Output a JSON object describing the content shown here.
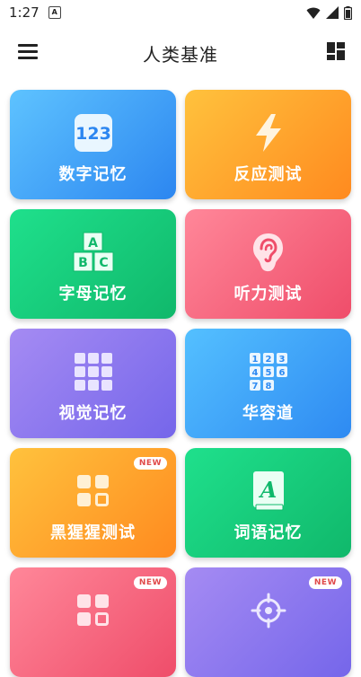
{
  "status": {
    "time": "1:27",
    "notif_icon": "a-icon"
  },
  "appbar": {
    "title": "人类基准",
    "menu_icon": "hamburger-menu-icon",
    "layout_icon": "dashboard-grid-icon"
  },
  "cards": [
    {
      "id": "number-memory",
      "label": "数字记忆",
      "icon": "number-123-icon",
      "badge": ""
    },
    {
      "id": "reaction-test",
      "label": "反应测试",
      "icon": "lightning-icon",
      "badge": ""
    },
    {
      "id": "letter-memory",
      "label": "字母记忆",
      "icon": "abc-blocks-icon",
      "badge": ""
    },
    {
      "id": "hearing-test",
      "label": "听力测试",
      "icon": "ear-icon",
      "badge": ""
    },
    {
      "id": "visual-memory",
      "label": "视觉记忆",
      "icon": "grid-squares-icon",
      "badge": ""
    },
    {
      "id": "klotski",
      "label": "华容道",
      "icon": "number-tiles-icon",
      "badge": ""
    },
    {
      "id": "chimp-test",
      "label": "黑猩猩测试",
      "icon": "four-squares-icon",
      "badge": "NEW"
    },
    {
      "id": "word-memory",
      "label": "词语记忆",
      "icon": "book-a-icon",
      "badge": ""
    },
    {
      "id": "card-9",
      "label": "",
      "icon": "four-squares-icon",
      "badge": "NEW"
    },
    {
      "id": "card-10",
      "label": "",
      "icon": "target-icon",
      "badge": "NEW"
    }
  ],
  "colors": {
    "blue": "#2c86f0",
    "orange": "#ff8a1f",
    "green": "#10b86b",
    "pink": "#ef4d6a",
    "purple": "#7566ea"
  }
}
